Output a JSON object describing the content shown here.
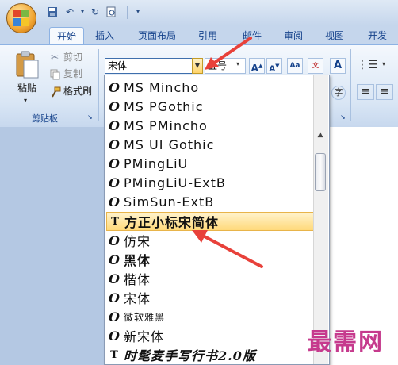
{
  "quick_access": [
    "save-icon",
    "undo-icon",
    "redo-icon",
    "print-preview-icon",
    "customize-icon"
  ],
  "tabs": [
    {
      "label": "开始",
      "active": true
    },
    {
      "label": "插入"
    },
    {
      "label": "页面布局"
    },
    {
      "label": "引用"
    },
    {
      "label": "邮件"
    },
    {
      "label": "审阅"
    },
    {
      "label": "视图"
    },
    {
      "label": "开发"
    }
  ],
  "clipboard": {
    "paste_label": "粘贴",
    "cut_label": "剪切",
    "copy_label": "复制",
    "format_painter_label": "格式刷",
    "group_label": "剪贴板"
  },
  "font": {
    "current_font": "宋体",
    "current_size": "五号"
  },
  "font_list": [
    "MS Mincho",
    "MS PGothic",
    "MS PMincho",
    "MS UI Gothic",
    "PMingLiU",
    "PMingLiU-ExtB",
    "SimSun-ExtB",
    "方正小标宋简体",
    "仿宋",
    "黑体",
    "楷体",
    "宋体",
    "微软雅黑",
    "新宋体",
    "时髦麦手写行书2.0版"
  ],
  "selected_font": "方正小标宋简体",
  "watermark": "最需网",
  "colors": {
    "accent": "#15428b",
    "highlight": "#ffd97a",
    "arrow": "#e8413a",
    "watermark": "#c63a8d"
  }
}
